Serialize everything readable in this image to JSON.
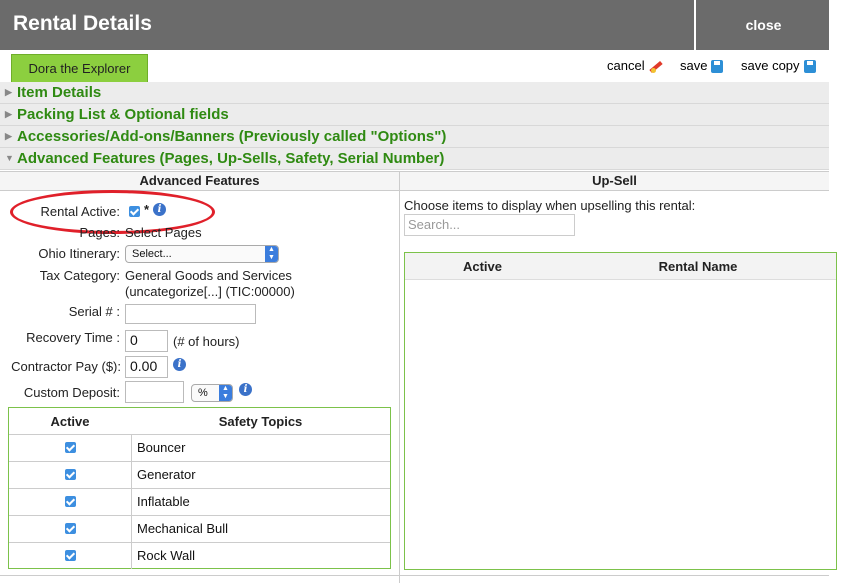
{
  "window": {
    "title": "Rental Details",
    "close_label": "close"
  },
  "rental_name_tab": "Dora the Explorer",
  "actions": {
    "cancel": "cancel",
    "save": "save",
    "save_copy": "save copy"
  },
  "sections": [
    "Item Details",
    "Packing List & Optional fields",
    "Accessories/Add-ons/Banners (Previously called \"Options\")",
    "Advanced Features (Pages, Up-Sells, Safety, Serial Number)"
  ],
  "advanced": {
    "heading": "Advanced Features",
    "rental_active_label": "Rental Active:",
    "rental_active_checked": true,
    "required_mark": "*",
    "pages_label": "Pages:",
    "pages_value": "Select Pages",
    "itinerary_label": "Ohio Itinerary:",
    "itinerary_value": "Select...",
    "tax_label": "Tax Category:",
    "tax_value_line1": "General Goods and Services",
    "tax_value_line2": "(uncategorize[...] (TIC:00000)",
    "serial_label": "Serial # :",
    "serial_value": "",
    "recovery_label": "Recovery Time :",
    "recovery_value": "0",
    "recovery_unit": "(# of hours)",
    "contractor_label": "Contractor Pay ($):",
    "contractor_value": "0.00",
    "deposit_label": "Custom Deposit:",
    "deposit_value": "",
    "deposit_unit": "%"
  },
  "safety": {
    "col_active": "Active",
    "col_topics": "Safety Topics",
    "rows": [
      {
        "topic": "Bouncer",
        "active": true
      },
      {
        "topic": "Generator",
        "active": true
      },
      {
        "topic": "Inflatable",
        "active": true
      },
      {
        "topic": "Mechanical Bull",
        "active": true
      },
      {
        "topic": "Rock Wall",
        "active": true
      }
    ]
  },
  "upsell": {
    "heading": "Up-Sell",
    "instructions": "Choose items to display when upselling this rental:",
    "search_placeholder": "Search...",
    "col_active": "Active",
    "col_name": "Rental Name"
  },
  "colors": {
    "accent_green": "#2f8a12",
    "tab_green": "#8ccf3f",
    "titlebar": "#6b6b6b",
    "annotation_red": "#e0202a"
  },
  "icons": [
    "pencil-cancel-icon",
    "save-disk-icon",
    "info-icon",
    "checkbox-icon",
    "triangle-icon"
  ]
}
